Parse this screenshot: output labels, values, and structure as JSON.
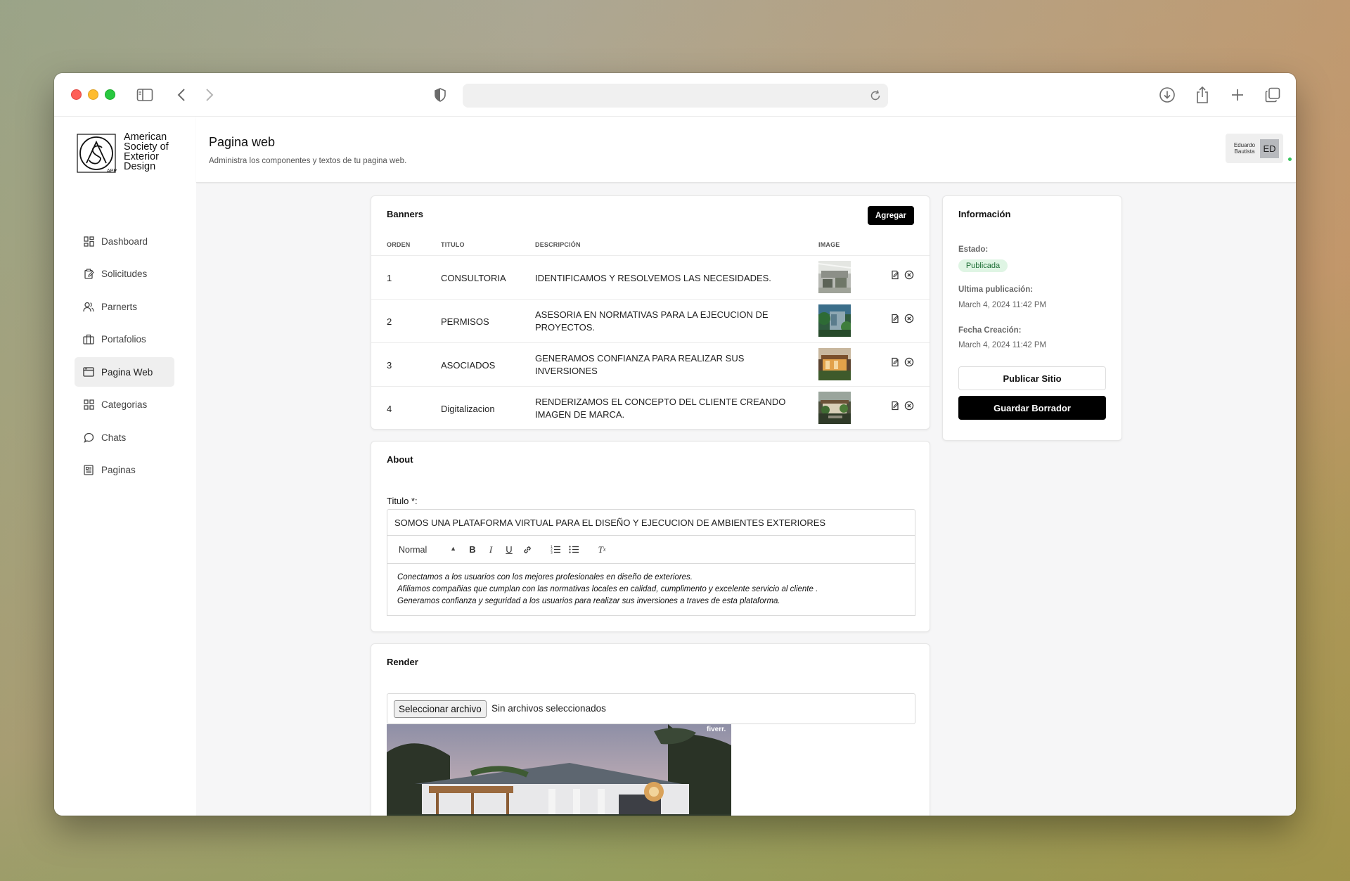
{
  "browser": {
    "url": ""
  },
  "sidebar": {
    "logo": {
      "lines": [
        "American",
        "Society of",
        "Exterior",
        "Design"
      ],
      "app_tag": "APP"
    },
    "items": [
      {
        "label": "Dashboard",
        "icon": "grid-icon"
      },
      {
        "label": "Solicitudes",
        "icon": "clipboard-edit-icon"
      },
      {
        "label": "Parnerts",
        "icon": "users-icon"
      },
      {
        "label": "Portafolios",
        "icon": "briefcase-icon"
      },
      {
        "label": "Pagina Web",
        "icon": "browser-window-icon",
        "active": true
      },
      {
        "label": "Categorias",
        "icon": "grid-icon"
      },
      {
        "label": "Chats",
        "icon": "chat-bubble-icon"
      },
      {
        "label": "Paginas",
        "icon": "document-list-icon"
      }
    ]
  },
  "header": {
    "title": "Pagina web",
    "subtitle": "Administra los componentes y textos de tu pagina web.",
    "user": {
      "name_line1": "Eduardo",
      "name_line2": "Bautista",
      "initials": "ED"
    }
  },
  "banners": {
    "title": "Banners",
    "add_label": "Agregar",
    "columns": [
      "ORDEN",
      "TITULO",
      "DESCRIPCIÓN",
      "IMAGE"
    ],
    "rows": [
      {
        "orden": "1",
        "titulo": "CONSULTORIA",
        "descripcion": "IDENTIFICAMOS Y RESOLVEMOS LAS NECESIDADES."
      },
      {
        "orden": "2",
        "titulo": "PERMISOS",
        "descripcion": "ASESORIA EN NORMATIVAS PARA LA EJECUCION DE PROYECTOS."
      },
      {
        "orden": "3",
        "titulo": "ASOCIADOS",
        "descripcion": "GENERAMOS CONFIANZA PARA REALIZAR SUS INVERSIONES"
      },
      {
        "orden": "4",
        "titulo": "Digitalizacion",
        "descripcion": "RENDERIZAMOS EL CONCEPTO DEL CLIENTE CREANDO IMAGEN DE MARCA."
      }
    ]
  },
  "info": {
    "title": "Información",
    "estado_label": "Estado:",
    "estado_value": "Publicada",
    "ultima_label": "Ultima publicación:",
    "ultima_value": "March 4, 2024 11:42 PM",
    "creacion_label": "Fecha Creación:",
    "creacion_value": "March 4, 2024 11:42 PM",
    "publish_label": "Publicar Sitio",
    "save_label": "Guardar Borrador"
  },
  "about": {
    "title": "About",
    "field_label": "Titulo *:",
    "field_value": "SOMOS UNA PLATAFORMA VIRTUAL PARA EL DISEÑO Y EJECUCION DE  AMBIENTES EXTERIORES",
    "editor_format": "Normal",
    "editor_lines": [
      "Conectamos a los usuarios con los mejores profesionales en diseño de exteriores.",
      "Afiliamos compañias que cumplan con las normativas locales en calidad, cumplimento y excelente servicio al cliente .",
      "Generamos confianza y seguridad a los usuarios para realizar sus inversiones a traves de esta plataforma."
    ]
  },
  "render": {
    "title": "Render",
    "file_button": "Seleccionar archivo",
    "file_status": "Sin archivos seleccionados",
    "watermark": "fiverr."
  }
}
